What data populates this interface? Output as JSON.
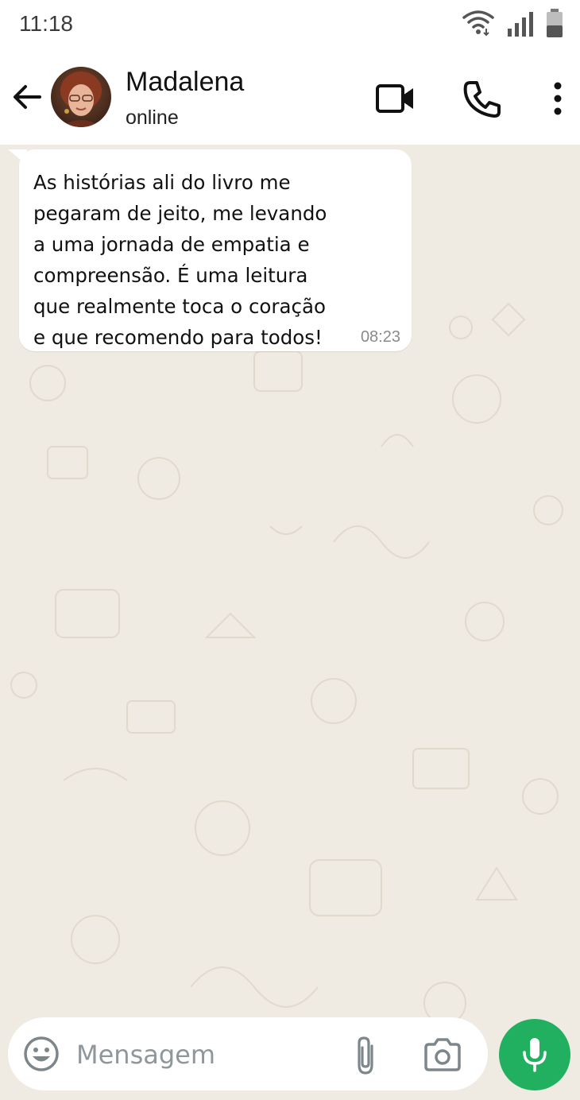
{
  "status_bar": {
    "time": "11:18",
    "icons": [
      "wifi-icon",
      "signal-icon",
      "battery-icon"
    ]
  },
  "header": {
    "back_icon": "arrow-left-icon",
    "contact_name": "Madalena",
    "contact_status": "online",
    "actions": [
      "video-call-icon",
      "phone-icon",
      "more-options-icon"
    ]
  },
  "messages": [
    {
      "direction": "incoming",
      "text": "As histórias ali do livro me\npegaram de jeito, me levando\na uma jornada de empatia e\ncompreensão. É uma leitura\nque realmente toca o coração\ne que recomendo para todos!",
      "time": "08:23"
    }
  ],
  "composer": {
    "placeholder": "Mensagem",
    "value": "",
    "icons": [
      "emoji-icon",
      "paperclip-icon",
      "camera-icon",
      "microphone-icon"
    ]
  },
  "colors": {
    "chat_background": "#efeae2",
    "bubble": "#ffffff",
    "accent_green": "#21b060"
  }
}
